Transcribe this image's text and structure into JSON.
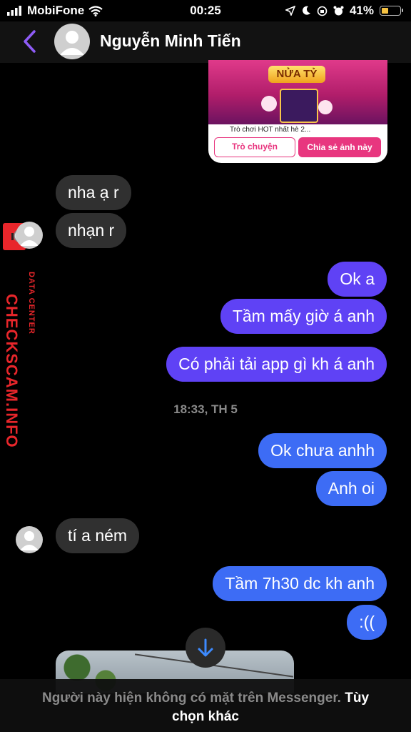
{
  "status_bar": {
    "carrier": "MobiFone",
    "time": "00:25",
    "battery": "41%",
    "battery_level": 0.41,
    "accent_battery": "#f5c242"
  },
  "header": {
    "contact_name": "Nguyễn Minh Tiến",
    "accent": "#8f5cf7"
  },
  "shared_card": {
    "logo_text": "NỬA TỶ",
    "caption": "Trò chơi HOT nhất hè 2...",
    "button_chat": "Trò chuyện",
    "button_share": "Chia sẻ ảnh này"
  },
  "messages": [
    {
      "side": "in",
      "text": "nha ạ r"
    },
    {
      "side": "in",
      "text": "nhạn r"
    },
    {
      "side": "out",
      "text": "Ok a"
    },
    {
      "side": "out",
      "text": "Tầm mấy giờ á anh"
    },
    {
      "side": "out",
      "text": "Có phải tải app gì kh á anh"
    },
    {
      "side": "out",
      "text": "Ok chưa anhh"
    },
    {
      "side": "out",
      "text": "Anh oi"
    },
    {
      "side": "in",
      "text": "tí a ném"
    },
    {
      "side": "out",
      "text": "Tầm 7h30 dc kh anh"
    },
    {
      "side": "out",
      "text": ":(("
    }
  ],
  "timestamp": "18:33, TH 5",
  "watermark": {
    "main": "CHECKSCAM.INFO",
    "sub": "DATA CENTER"
  },
  "footer": {
    "notice": "Người này hiện không có mặt trên Messenger.",
    "option": "Tùy",
    "option_line2": "chọn khác"
  },
  "colors": {
    "outgoing_purple": "#5f42f5",
    "outgoing_blue": "#3d6cf5",
    "incoming": "#303030",
    "card_pink": "#e8367f"
  }
}
